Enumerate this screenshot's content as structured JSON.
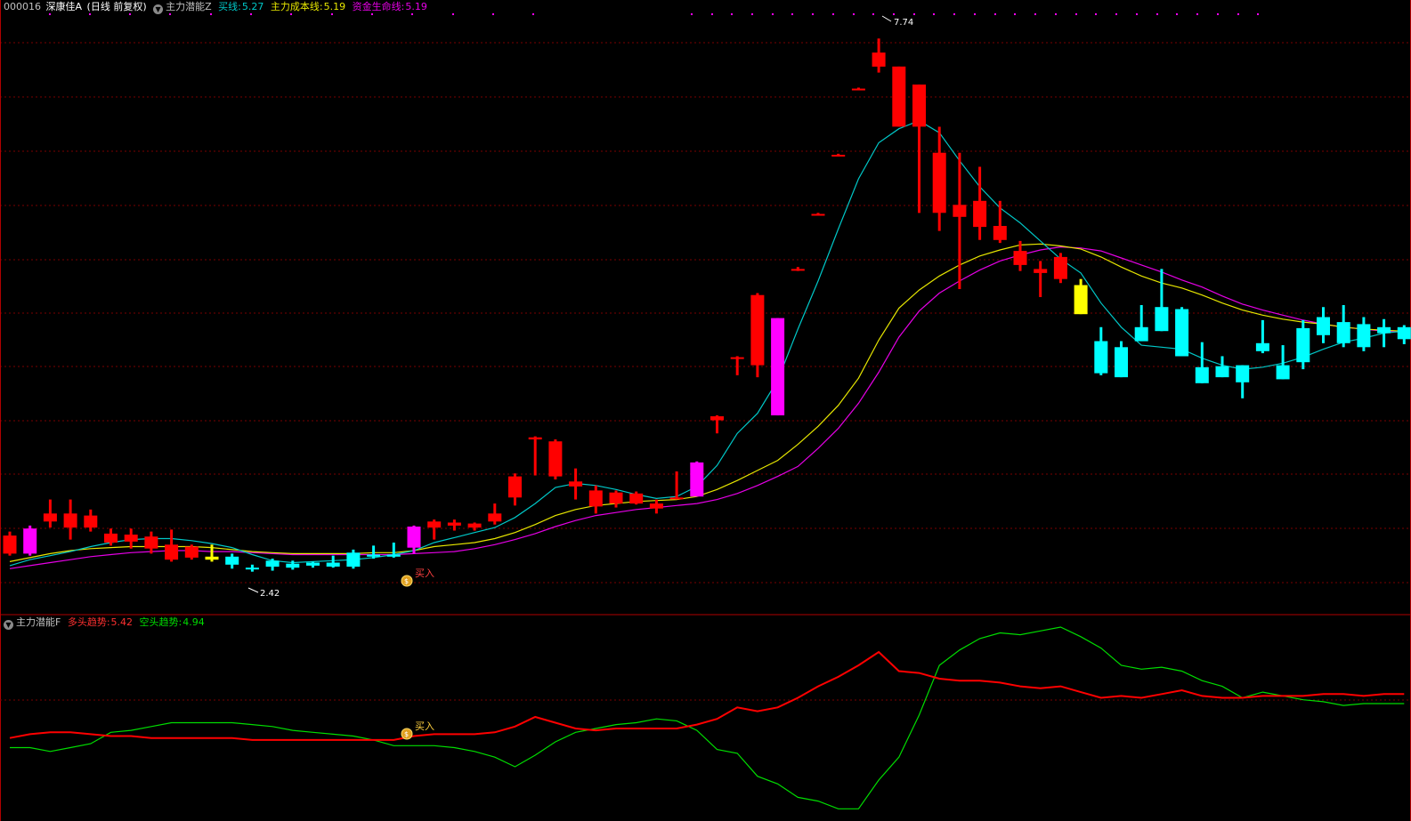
{
  "header": {
    "code": "000016",
    "name": "深康佳A",
    "period": "(日线 前复权)",
    "indicator": "主力潜能Z",
    "buy_label": "买线:",
    "buy_value": "5.27",
    "cost_label": "主力成本线:",
    "cost_value": "5.19",
    "life_label": "资金生命线:",
    "life_value": "5.19"
  },
  "sub_header": {
    "indicator": "主力潜能F",
    "bull_label": "多头趋势:",
    "bull_value": "5.42",
    "bear_label": "空头趋势:",
    "bear_value": "4.94"
  },
  "colors": {
    "up": "#ff0000",
    "down": "#00ffff",
    "magenta": "#ff00ff",
    "yellow": "#ffff00",
    "grid": "#7a0000",
    "buy_line": "#00c8c8",
    "cost_line": "#e6e600",
    "life_line": "#e600e6",
    "bull": "#ff0000",
    "bear": "#00dd00"
  },
  "annotations": {
    "high_label": "7.74",
    "low_label": "2.42",
    "buy_signal": "买入",
    "buy_signal_sub": "买入"
  },
  "chart_data": [
    {
      "type": "candlestick",
      "ylim": [
        2.0,
        8.0
      ],
      "grid": true,
      "candles": [
        {
          "o": 2.78,
          "h": 2.82,
          "l": 2.58,
          "c": 2.6,
          "k": "up"
        },
        {
          "o": 2.6,
          "h": 2.88,
          "l": 2.58,
          "c": 2.85,
          "k": "magenta"
        },
        {
          "o": 3.0,
          "h": 3.14,
          "l": 2.86,
          "c": 2.92,
          "k": "up"
        },
        {
          "o": 3.0,
          "h": 3.14,
          "l": 2.74,
          "c": 2.86,
          "k": "up"
        },
        {
          "o": 2.98,
          "h": 3.04,
          "l": 2.82,
          "c": 2.86,
          "k": "up"
        },
        {
          "o": 2.8,
          "h": 2.85,
          "l": 2.68,
          "c": 2.71,
          "k": "up"
        },
        {
          "o": 2.79,
          "h": 2.85,
          "l": 2.65,
          "c": 2.72,
          "k": "up"
        },
        {
          "o": 2.77,
          "h": 2.82,
          "l": 2.6,
          "c": 2.65,
          "k": "up"
        },
        {
          "o": 2.69,
          "h": 2.84,
          "l": 2.52,
          "c": 2.54,
          "k": "up"
        },
        {
          "o": 2.67,
          "h": 2.69,
          "l": 2.54,
          "c": 2.56,
          "k": "up"
        },
        {
          "o": 2.54,
          "h": 2.69,
          "l": 2.52,
          "c": 2.57,
          "k": "yellow"
        },
        {
          "o": 2.49,
          "h": 2.6,
          "l": 2.45,
          "c": 2.57,
          "k": "down"
        },
        {
          "o": 2.46,
          "h": 2.49,
          "l": 2.42,
          "c": 2.45,
          "k": "down"
        },
        {
          "o": 2.47,
          "h": 2.55,
          "l": 2.43,
          "c": 2.53,
          "k": "down"
        },
        {
          "o": 2.46,
          "h": 2.53,
          "l": 2.44,
          "c": 2.5,
          "k": "down"
        },
        {
          "o": 2.48,
          "h": 2.52,
          "l": 2.46,
          "c": 2.51,
          "k": "down"
        },
        {
          "o": 2.47,
          "h": 2.58,
          "l": 2.46,
          "c": 2.51,
          "k": "down"
        },
        {
          "o": 2.47,
          "h": 2.64,
          "l": 2.45,
          "c": 2.61,
          "k": "down"
        },
        {
          "o": 2.57,
          "h": 2.68,
          "l": 2.55,
          "c": 2.59,
          "k": "down"
        },
        {
          "o": 2.57,
          "h": 2.71,
          "l": 2.56,
          "c": 2.59,
          "k": "down"
        },
        {
          "o": 2.66,
          "h": 2.88,
          "l": 2.6,
          "c": 2.87,
          "k": "magenta"
        },
        {
          "o": 2.92,
          "h": 2.94,
          "l": 2.74,
          "c": 2.86,
          "k": "up"
        },
        {
          "o": 2.91,
          "h": 2.94,
          "l": 2.83,
          "c": 2.88,
          "k": "up"
        },
        {
          "o": 2.9,
          "h": 2.91,
          "l": 2.83,
          "c": 2.86,
          "k": "up"
        },
        {
          "o": 3.0,
          "h": 3.1,
          "l": 2.89,
          "c": 2.92,
          "k": "up"
        },
        {
          "o": 3.37,
          "h": 3.4,
          "l": 3.08,
          "c": 3.16,
          "k": "up"
        },
        {
          "o": 3.74,
          "h": 3.77,
          "l": 3.38,
          "c": 3.76,
          "k": "up"
        },
        {
          "o": 3.72,
          "h": 3.74,
          "l": 3.34,
          "c": 3.37,
          "k": "up"
        },
        {
          "o": 3.32,
          "h": 3.45,
          "l": 3.14,
          "c": 3.27,
          "k": "up"
        },
        {
          "o": 3.23,
          "h": 3.28,
          "l": 3.0,
          "c": 3.07,
          "k": "up"
        },
        {
          "o": 3.21,
          "h": 3.23,
          "l": 3.06,
          "c": 3.1,
          "k": "up"
        },
        {
          "o": 3.2,
          "h": 3.22,
          "l": 3.09,
          "c": 3.1,
          "k": "up"
        },
        {
          "o": 3.1,
          "h": 3.14,
          "l": 3.0,
          "c": 3.05,
          "k": "up"
        },
        {
          "o": 3.15,
          "h": 3.42,
          "l": 3.14,
          "c": 3.16,
          "k": "up"
        },
        {
          "o": 3.17,
          "h": 3.52,
          "l": 3.17,
          "c": 3.51,
          "k": "magenta"
        },
        {
          "o": 3.97,
          "h": 3.98,
          "l": 3.8,
          "c": 3.93,
          "k": "up"
        },
        {
          "o": 4.56,
          "h": 4.57,
          "l": 4.38,
          "c": 4.55,
          "k": "up"
        },
        {
          "o": 5.18,
          "h": 5.2,
          "l": 4.36,
          "c": 4.48,
          "k": "up"
        },
        {
          "o": 3.98,
          "h": 4.95,
          "l": 3.98,
          "c": 4.95,
          "k": "magenta"
        },
        {
          "o": 5.44,
          "h": 5.46,
          "l": 5.42,
          "c": 5.44,
          "k": "up"
        },
        {
          "o": 5.99,
          "h": 6.0,
          "l": 5.98,
          "c": 5.99,
          "k": "up"
        },
        {
          "o": 6.58,
          "h": 6.59,
          "l": 6.57,
          "c": 6.58,
          "k": "up"
        },
        {
          "o": 7.24,
          "h": 7.25,
          "l": 7.23,
          "c": 7.24,
          "k": "up"
        },
        {
          "o": 7.46,
          "h": 7.74,
          "l": 7.4,
          "c": 7.6,
          "k": "up"
        },
        {
          "o": 7.46,
          "h": 7.46,
          "l": 6.86,
          "c": 6.86,
          "k": "up"
        },
        {
          "o": 7.28,
          "h": 7.28,
          "l": 6.0,
          "c": 6.86,
          "k": "up"
        },
        {
          "o": 6.6,
          "h": 6.86,
          "l": 5.82,
          "c": 6.0,
          "k": "up"
        },
        {
          "o": 6.08,
          "h": 6.6,
          "l": 5.24,
          "c": 5.96,
          "k": "up"
        },
        {
          "o": 6.12,
          "h": 6.46,
          "l": 5.73,
          "c": 5.86,
          "k": "up"
        },
        {
          "o": 5.87,
          "h": 6.12,
          "l": 5.7,
          "c": 5.73,
          "k": "up"
        },
        {
          "o": 5.62,
          "h": 5.72,
          "l": 5.42,
          "c": 5.48,
          "k": "up"
        },
        {
          "o": 5.44,
          "h": 5.52,
          "l": 5.16,
          "c": 5.4,
          "k": "up"
        },
        {
          "o": 5.56,
          "h": 5.6,
          "l": 5.3,
          "c": 5.34,
          "k": "up"
        },
        {
          "o": 4.99,
          "h": 5.34,
          "l": 4.99,
          "c": 5.28,
          "k": "yellow"
        },
        {
          "o": 4.4,
          "h": 4.86,
          "l": 4.38,
          "c": 4.72,
          "k": "down"
        },
        {
          "o": 4.36,
          "h": 4.72,
          "l": 4.36,
          "c": 4.66,
          "k": "down"
        },
        {
          "o": 4.72,
          "h": 5.08,
          "l": 4.72,
          "c": 4.86,
          "k": "down"
        },
        {
          "o": 4.82,
          "h": 5.44,
          "l": 4.82,
          "c": 5.06,
          "k": "down"
        },
        {
          "o": 4.57,
          "h": 5.06,
          "l": 4.57,
          "c": 5.04,
          "k": "down"
        },
        {
          "o": 4.3,
          "h": 4.71,
          "l": 4.3,
          "c": 4.46,
          "k": "down"
        },
        {
          "o": 4.36,
          "h": 4.57,
          "l": 4.36,
          "c": 4.47,
          "k": "down"
        },
        {
          "o": 4.31,
          "h": 4.48,
          "l": 4.15,
          "c": 4.48,
          "k": "down"
        },
        {
          "o": 4.62,
          "h": 4.93,
          "l": 4.6,
          "c": 4.7,
          "k": "down"
        },
        {
          "o": 4.34,
          "h": 4.68,
          "l": 4.34,
          "c": 4.48,
          "k": "down"
        },
        {
          "o": 4.51,
          "h": 4.93,
          "l": 4.44,
          "c": 4.85,
          "k": "down"
        },
        {
          "o": 4.78,
          "h": 5.06,
          "l": 4.7,
          "c": 4.96,
          "k": "down"
        },
        {
          "o": 4.7,
          "h": 5.08,
          "l": 4.66,
          "c": 4.91,
          "k": "down"
        },
        {
          "o": 4.66,
          "h": 4.96,
          "l": 4.62,
          "c": 4.89,
          "k": "down"
        },
        {
          "o": 4.8,
          "h": 4.94,
          "l": 4.66,
          "c": 4.86,
          "k": "down"
        },
        {
          "o": 4.74,
          "h": 4.88,
          "l": 4.69,
          "c": 4.86,
          "k": "down"
        }
      ],
      "series": [
        {
          "values": [
            2.48,
            2.54,
            2.58,
            2.62,
            2.67,
            2.71,
            2.74,
            2.75,
            2.75,
            2.73,
            2.7,
            2.66,
            2.59,
            2.53,
            2.51,
            2.52,
            2.53,
            2.54,
            2.56,
            2.59,
            2.63,
            2.71,
            2.76,
            2.81,
            2.86,
            2.96,
            3.1,
            3.26,
            3.3,
            3.28,
            3.24,
            3.19,
            3.15,
            3.17,
            3.27,
            3.48,
            3.8,
            4.0,
            4.33,
            4.84,
            5.32,
            5.84,
            6.34,
            6.7,
            6.84,
            6.92,
            6.8,
            6.52,
            6.26,
            6.05,
            5.9,
            5.72,
            5.54,
            5.4,
            5.1,
            4.86,
            4.68,
            4.66,
            4.64,
            4.55,
            4.48,
            4.44,
            4.46,
            4.5,
            4.56,
            4.64,
            4.71,
            4.75,
            4.8,
            4.82
          ]
        },
        {
          "values": [
            2.52,
            2.56,
            2.6,
            2.63,
            2.65,
            2.66,
            2.67,
            2.67,
            2.67,
            2.67,
            2.66,
            2.64,
            2.62,
            2.61,
            2.6,
            2.6,
            2.6,
            2.6,
            2.61,
            2.61,
            2.63,
            2.67,
            2.69,
            2.71,
            2.75,
            2.81,
            2.89,
            2.98,
            3.04,
            3.08,
            3.1,
            3.12,
            3.13,
            3.14,
            3.17,
            3.24,
            3.33,
            3.43,
            3.53,
            3.69,
            3.87,
            4.08,
            4.35,
            4.73,
            5.05,
            5.23,
            5.37,
            5.48,
            5.57,
            5.63,
            5.68,
            5.69,
            5.67,
            5.64,
            5.56,
            5.46,
            5.37,
            5.3,
            5.25,
            5.18,
            5.1,
            5.03,
            4.98,
            4.94,
            4.91,
            4.89,
            4.86,
            4.84,
            4.83,
            4.82
          ]
        },
        {
          "values": [
            2.45,
            2.48,
            2.51,
            2.54,
            2.57,
            2.59,
            2.61,
            2.62,
            2.63,
            2.63,
            2.62,
            2.62,
            2.61,
            2.6,
            2.59,
            2.59,
            2.59,
            2.59,
            2.59,
            2.59,
            2.6,
            2.61,
            2.62,
            2.65,
            2.69,
            2.74,
            2.8,
            2.87,
            2.93,
            2.98,
            3.01,
            3.04,
            3.06,
            3.08,
            3.1,
            3.14,
            3.2,
            3.28,
            3.37,
            3.47,
            3.65,
            3.85,
            4.1,
            4.41,
            4.76,
            5.02,
            5.2,
            5.32,
            5.43,
            5.52,
            5.58,
            5.63,
            5.66,
            5.65,
            5.62,
            5.55,
            5.48,
            5.41,
            5.33,
            5.26,
            5.17,
            5.09,
            5.03,
            4.98,
            4.93,
            4.89,
            4.86,
            4.84,
            4.82,
            4.81
          ]
        }
      ]
    },
    {
      "type": "line",
      "series": [
        {
          "values": [
            0.42,
            0.44,
            0.45,
            0.45,
            0.44,
            0.43,
            0.43,
            0.42,
            0.42,
            0.42,
            0.42,
            0.42,
            0.41,
            0.41,
            0.41,
            0.41,
            0.41,
            0.41,
            0.41,
            0.41,
            0.43,
            0.44,
            0.44,
            0.44,
            0.45,
            0.48,
            0.53,
            0.5,
            0.47,
            0.46,
            0.47,
            0.47,
            0.47,
            0.47,
            0.49,
            0.52,
            0.58,
            0.56,
            0.58,
            0.63,
            0.69,
            0.74,
            0.8,
            0.87,
            0.77,
            0.76,
            0.73,
            0.72,
            0.72,
            0.71,
            0.69,
            0.68,
            0.69,
            0.66,
            0.63,
            0.64,
            0.63,
            0.65,
            0.67,
            0.64,
            0.63,
            0.63,
            0.64,
            0.64,
            0.64,
            0.65,
            0.65,
            0.64,
            0.65,
            0.65
          ]
        },
        {
          "values": [
            0.37,
            0.37,
            0.35,
            0.37,
            0.39,
            0.45,
            0.46,
            0.48,
            0.5,
            0.5,
            0.5,
            0.5,
            0.49,
            0.48,
            0.46,
            0.45,
            0.44,
            0.43,
            0.41,
            0.38,
            0.38,
            0.38,
            0.37,
            0.35,
            0.32,
            0.27,
            0.33,
            0.4,
            0.45,
            0.47,
            0.49,
            0.5,
            0.52,
            0.51,
            0.46,
            0.36,
            0.34,
            0.22,
            0.18,
            0.11,
            0.09,
            0.05,
            0.05,
            0.2,
            0.32,
            0.54,
            0.8,
            0.88,
            0.94,
            0.97,
            0.96,
            0.98,
            1.0,
            0.95,
            0.89,
            0.8,
            0.78,
            0.79,
            0.77,
            0.72,
            0.69,
            0.63,
            0.66,
            0.64,
            0.62,
            0.61,
            0.59,
            0.6,
            0.6,
            0.6
          ]
        }
      ]
    }
  ]
}
